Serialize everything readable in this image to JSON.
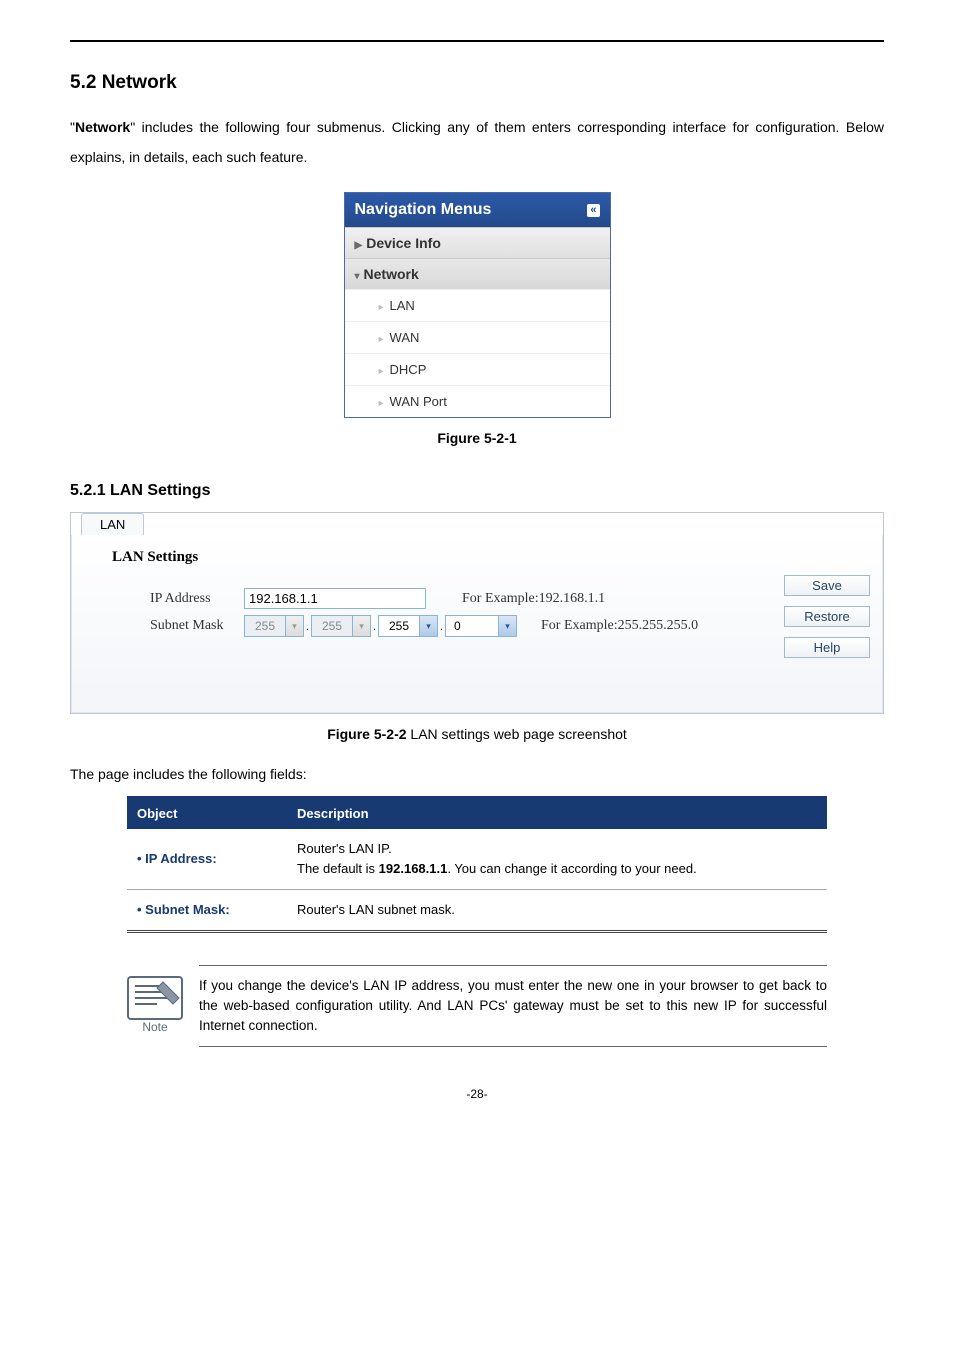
{
  "section": {
    "heading": "5.2  Network",
    "intro_pre": "\"",
    "intro_bold": "Network",
    "intro_post": "\" includes the following four submenus. Clicking any of them enters corresponding interface for configuration. Below explains, in details, each such feature."
  },
  "nav": {
    "title": "Navigation Menus",
    "items": {
      "device_info": "Device Info",
      "network": "Network",
      "lan": "LAN",
      "wan": "WAN",
      "dhcp": "DHCP",
      "wan_port": "WAN Port"
    }
  },
  "figure1_caption": "Figure 5-2-1",
  "subsection_heading": "5.2.1  LAN Settings",
  "lan_panel": {
    "tab": "LAN",
    "title": "LAN Settings",
    "ip_label": "IP Address",
    "ip_value": "192.168.1.1",
    "ip_hint": "For Example:192.168.1.1",
    "mask_label": "Subnet Mask",
    "mask_oct1": "255",
    "mask_oct2": "255",
    "mask_oct3": "255",
    "mask_oct4": "0",
    "mask_hint": "For Example:255.255.255.0",
    "buttons": {
      "save": "Save",
      "restore": "Restore",
      "help": "Help"
    }
  },
  "figure2": {
    "label": "Figure 5-2-2",
    "text": " LAN settings web page screenshot"
  },
  "fields_intro": "The page includes the following fields:",
  "table": {
    "head_object": "Object",
    "head_desc": "Description",
    "rows": [
      {
        "object": "IP Address:",
        "desc_line1": "Router's LAN IP.",
        "desc_line2_pre": "The default is ",
        "desc_line2_bold": "192.168.1.1",
        "desc_line2_post": ". You can change it according to your need."
      },
      {
        "object": "Subnet Mask:",
        "desc": "Router's LAN subnet mask."
      }
    ]
  },
  "note": {
    "label": "Note",
    "text": "If you change the device's LAN IP address, you must enter the new one in your browser to get back to the web-based configuration utility. And LAN PCs' gateway must be set to this new IP for successful Internet connection."
  },
  "page_number": "-28-"
}
